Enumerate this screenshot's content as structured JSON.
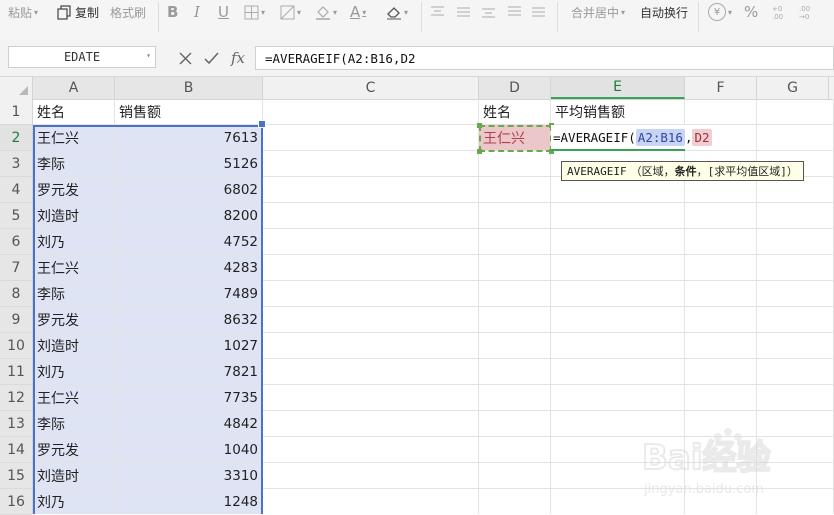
{
  "ribbon": {
    "paste_label": "粘贴",
    "copy_label": "复制",
    "format_painter_label": "格式刷",
    "bold_label": "B",
    "italic_label": "I",
    "underline_label": "U",
    "font_color_label": "A",
    "merge_center_label": "合并居中",
    "wrap_text_label": "自动换行",
    "currency_label": "¥",
    "percent_label": "%"
  },
  "formula_bar": {
    "name_box": "EDATE",
    "cancel_icon": "close-icon",
    "confirm_icon": "check-icon",
    "fx_label": "fx",
    "formula": "=AVERAGEIF(A2:B16,D2"
  },
  "columns": [
    "A",
    "B",
    "C",
    "D",
    "E",
    "F",
    "G"
  ],
  "rows": [
    "1",
    "2",
    "3",
    "4",
    "5",
    "6",
    "7",
    "8",
    "9",
    "10",
    "11",
    "12",
    "13",
    "14",
    "15",
    "16"
  ],
  "header_row": {
    "a": "姓名",
    "b": "销售额",
    "d": "姓名",
    "e": "平均销售额"
  },
  "data_rows": [
    {
      "name": "王仁兴",
      "sales": "7613"
    },
    {
      "name": "李际",
      "sales": "5126"
    },
    {
      "name": "罗元发",
      "sales": "6802"
    },
    {
      "name": "刘造时",
      "sales": "8200"
    },
    {
      "name": "刘乃",
      "sales": "4752"
    },
    {
      "name": "王仁兴",
      "sales": "4283"
    },
    {
      "name": "李际",
      "sales": "7489"
    },
    {
      "name": "罗元发",
      "sales": "8632"
    },
    {
      "name": "刘造时",
      "sales": "1027"
    },
    {
      "name": "刘乃",
      "sales": "7821"
    },
    {
      "name": "王仁兴",
      "sales": "7735"
    },
    {
      "name": "李际",
      "sales": "4842"
    },
    {
      "name": "罗元发",
      "sales": "1040"
    },
    {
      "name": "刘造时",
      "sales": "3310"
    },
    {
      "name": "刘乃",
      "sales": "1248"
    }
  ],
  "criteria_cell": "王仁兴",
  "editing": {
    "prefix": "=AVERAGEIF(",
    "ref_range": "A2:B16",
    "comma": ",",
    "ref_criteria": "D2"
  },
  "tooltip": {
    "func": "AVERAGEIF",
    "open": "（区域，",
    "bold_arg": "条件",
    "rest": "，[求平均值区域]）"
  },
  "watermark": {
    "brand": "Bai经验",
    "url": "jingyan.baidu.com"
  },
  "colors": {
    "selection_fill": "#dfe4f4",
    "range_border": "#4a72c8",
    "criteria_fill": "#ecc7c9",
    "criteria_border": "#6aa84f",
    "active_header": "#1f7c3e"
  }
}
